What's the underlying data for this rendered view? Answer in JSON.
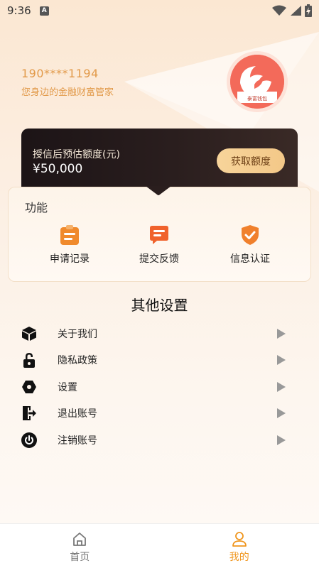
{
  "status_bar": {
    "time": "9:36",
    "notification_icon": "A"
  },
  "profile": {
    "phone": "190****1194",
    "slogan": "您身边的金融财富管家",
    "avatar_caption": "泰富钱包"
  },
  "credit": {
    "label": "授信后预估额度(元)",
    "amount": "¥50,000",
    "button": "获取额度"
  },
  "functions": {
    "title": "功能",
    "items": [
      {
        "label": "申请记录",
        "icon": "clipboard-icon"
      },
      {
        "label": "提交反馈",
        "icon": "chat-icon"
      },
      {
        "label": "信息认证",
        "icon": "shield-check-icon"
      }
    ]
  },
  "settings": {
    "title": "其他设置",
    "items": [
      {
        "label": "关于我们",
        "icon": "cube-icon"
      },
      {
        "label": "隐私政策",
        "icon": "lock-icon"
      },
      {
        "label": "设置",
        "icon": "hexagon-icon"
      },
      {
        "label": "退出账号",
        "icon": "exit-icon"
      },
      {
        "label": "注销账号",
        "icon": "power-icon"
      }
    ]
  },
  "tabs": [
    {
      "label": "首页",
      "icon": "home-icon",
      "active": false
    },
    {
      "label": "我的",
      "icon": "user-icon",
      "active": true
    }
  ],
  "colors": {
    "accent": "#f08a2c",
    "phone_text": "#e29a4a",
    "tab_active": "#f0961e",
    "tab_inactive": "#777777"
  }
}
